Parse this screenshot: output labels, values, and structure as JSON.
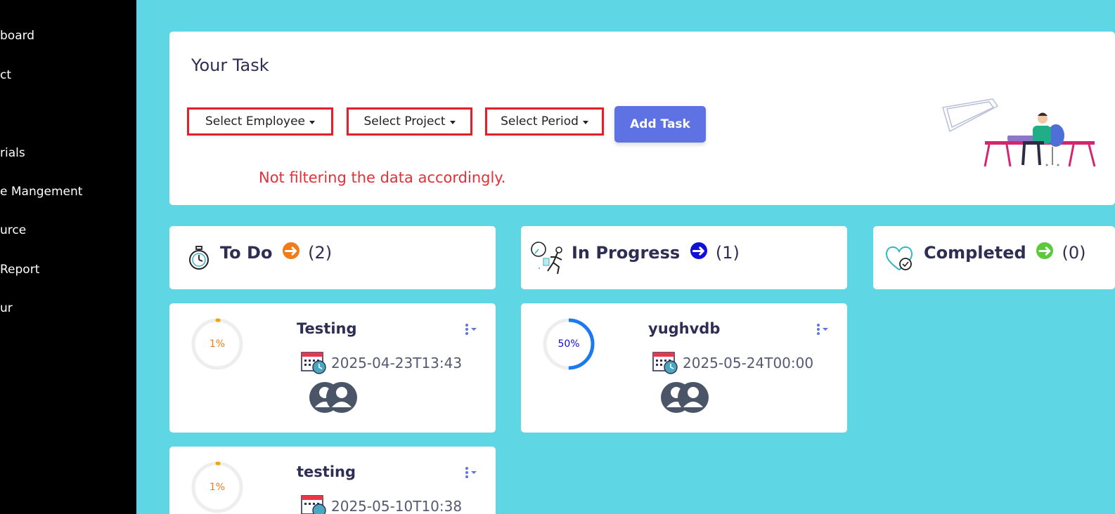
{
  "sidebar": {
    "items": [
      {
        "label": "board"
      },
      {
        "label": "ct"
      },
      {
        "label": "rials"
      },
      {
        "label": "e Mangement"
      },
      {
        "label": "urce"
      },
      {
        "label": "Report"
      },
      {
        "label": "ur"
      }
    ]
  },
  "task_panel": {
    "title": "Your Task",
    "filters": {
      "employee": "Select Employee",
      "project": "Select Project",
      "period": "Select Period"
    },
    "add_button": "Add Task",
    "annotation": "Not filtering the data accordingly."
  },
  "columns": [
    {
      "title": "To Do",
      "count": "(2)",
      "accent": "#f07c1a",
      "cards": [
        {
          "name": "Testing",
          "date": "2025-04-23T13:43",
          "progress_label": "1%",
          "progress": 1
        },
        {
          "name": "testing",
          "date": "2025-05-10T10:38",
          "progress_label": "1%",
          "progress": 1
        }
      ]
    },
    {
      "title": "In Progress",
      "count": "(1)",
      "accent": "#1010d8",
      "cards": [
        {
          "name": "yughvdb",
          "date": "2025-05-24T00:00",
          "progress_label": "50%",
          "progress": 50
        }
      ]
    },
    {
      "title": "Completed",
      "count": "(0)",
      "accent": "#5cc93a",
      "cards": []
    }
  ],
  "colors": {
    "background": "#5fd6e3",
    "primary": "#5e72e4",
    "annotation_red": "#e0202a"
  }
}
